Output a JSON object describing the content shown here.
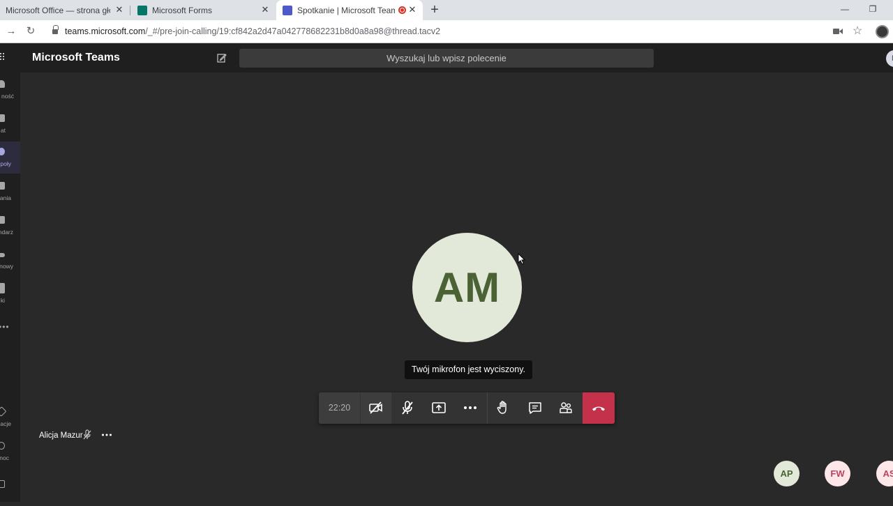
{
  "browser": {
    "tabs": [
      {
        "title": "Microsoft Office — strona główna",
        "favicon_color": "#d83b01"
      },
      {
        "title": "Microsoft Forms",
        "favicon_color": "#077568"
      },
      {
        "title": "Spotkanie | Microsoft Teams",
        "favicon_color": "#5059c9",
        "recording": true,
        "active": true
      }
    ],
    "new_tab_icon": "plus-icon",
    "url_host": "teams.microsoft.com",
    "url_path": "/_#/pre-join-calling/19:cf842a2d47a042778682231b8d0a8a98@thread.tacv2"
  },
  "teams": {
    "app_title": "Microsoft Teams",
    "search_placeholder": "Wyszukaj lub wpisz polecenie",
    "user_initial": "N"
  },
  "rail": {
    "items": [
      {
        "label": "Aktywność",
        "visible_label": "ność",
        "icon": "bell-icon"
      },
      {
        "label": "Czat",
        "visible_label": "at",
        "icon": "chat-icon"
      },
      {
        "label": "Zespoły",
        "visible_label": "poły",
        "icon": "teams-icon",
        "active": true
      },
      {
        "label": "Zadania",
        "visible_label": "ania",
        "icon": "assignments-icon"
      },
      {
        "label": "Kalendarz",
        "visible_label": "ndarz",
        "icon": "calendar-icon"
      },
      {
        "label": "Połączenia",
        "visible_label": "nowy",
        "icon": "calls-icon"
      },
      {
        "label": "Pliki",
        "visible_label": "ki",
        "icon": "files-icon"
      }
    ],
    "bottom_items": [
      {
        "label": "Aplikacje",
        "visible_label": "acje",
        "icon": "apps-icon"
      },
      {
        "label": "Pomoc",
        "visible_label": "noc",
        "icon": "help-icon"
      }
    ]
  },
  "meeting": {
    "main_participant_initials": "AM",
    "mic_muted_notice": "Twój mikrofon jest wyciszony.",
    "timer": "22:20",
    "self_name": "Alicja Mazur",
    "participants": [
      {
        "initials": "AP",
        "bg": "#e3e9d9",
        "fg": "#4b6234"
      },
      {
        "initials": "FW",
        "bg": "#fde7e9",
        "fg": "#b8445f"
      },
      {
        "initials": "AS",
        "bg": "#fde7e9",
        "fg": "#b8445f"
      }
    ],
    "controls": [
      {
        "name": "camera-off-button",
        "icon": "video-off-icon"
      },
      {
        "name": "mic-off-button",
        "icon": "mic-off-icon"
      },
      {
        "name": "share-button",
        "icon": "share-screen-icon"
      },
      {
        "name": "more-actions-button",
        "icon": "ellipsis-icon"
      },
      {
        "name": "raise-hand-button",
        "icon": "hand-icon"
      },
      {
        "name": "chat-button",
        "icon": "chat-icon"
      },
      {
        "name": "participants-button",
        "icon": "people-icon"
      },
      {
        "name": "hang-up-button",
        "icon": "hang-up-icon"
      }
    ],
    "hangup_color": "#c4314b"
  }
}
